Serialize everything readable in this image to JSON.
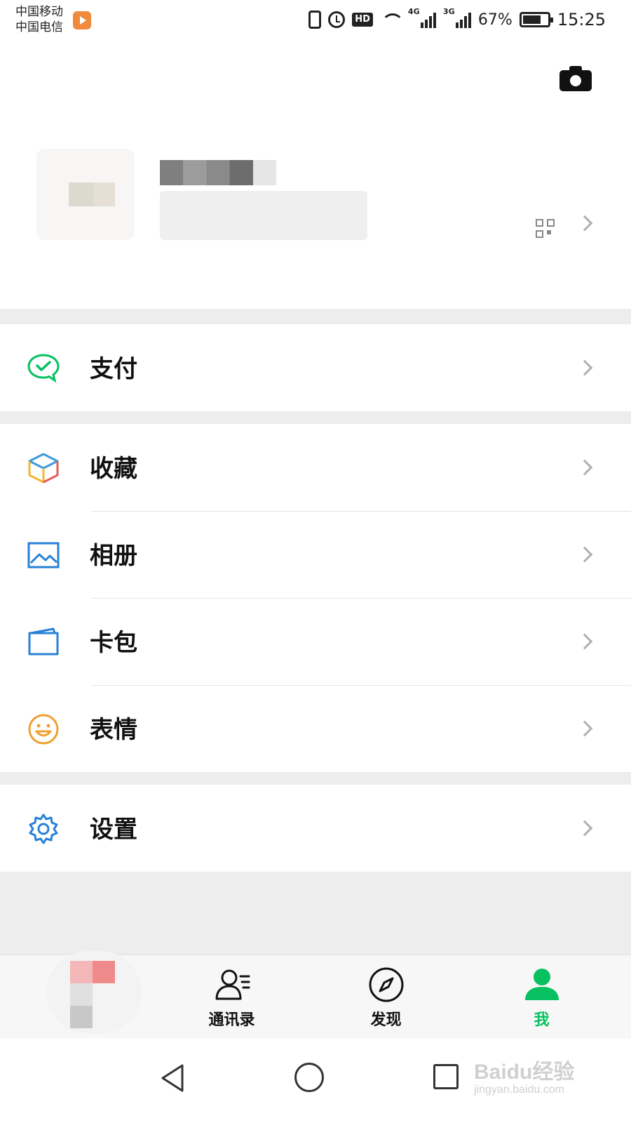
{
  "status_bar": {
    "carrier_1": "中国移动",
    "carrier_2": "中国电信",
    "net_1": "4G",
    "net_2": "3G",
    "battery_percent": "67%",
    "time": "15:25",
    "icons": [
      "vibrate-icon",
      "alarm-icon",
      "hd-icon",
      "wifi-icon",
      "signal-icon",
      "battery-icon"
    ]
  },
  "profile": {
    "camera_icon": "camera-icon",
    "qr_icon": "qr-code-icon"
  },
  "menu": {
    "pay": {
      "label": "支付",
      "icon": "wechat-pay-icon",
      "color": "#07c160"
    },
    "favorites": {
      "label": "收藏",
      "icon": "cube-icon"
    },
    "album": {
      "label": "相册",
      "icon": "image-icon",
      "color": "#2782d7"
    },
    "cards": {
      "label": "卡包",
      "icon": "card-icon",
      "color": "#2782d7"
    },
    "stickers": {
      "label": "表情",
      "icon": "smile-icon",
      "color": "#f0a030"
    },
    "settings": {
      "label": "设置",
      "icon": "gear-icon",
      "color": "#2782d7"
    }
  },
  "tabbar": {
    "contacts": "通讯录",
    "discover": "发现",
    "me": "我",
    "active_color": "#07c160"
  },
  "watermark": {
    "brand": "Baidu经验",
    "url": "jingyan.baidu.com"
  }
}
